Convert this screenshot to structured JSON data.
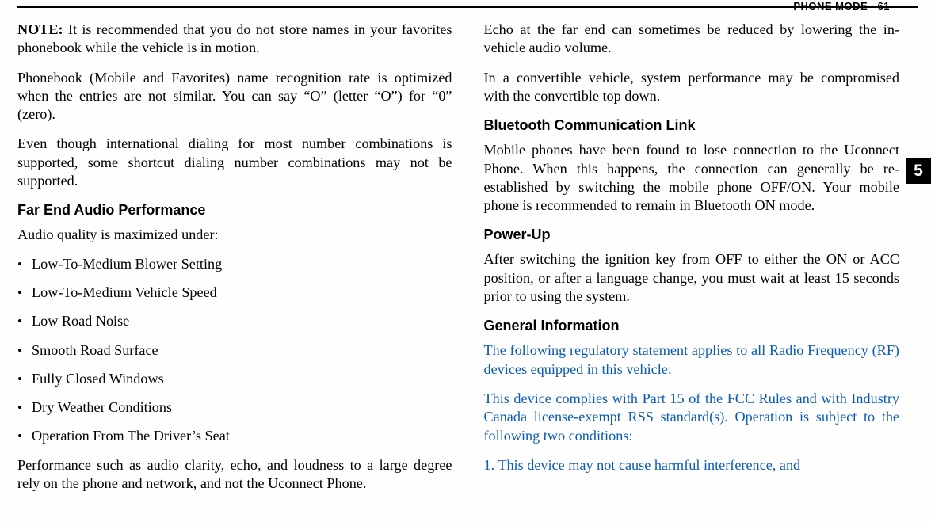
{
  "header": {
    "section": "PHONE MODE",
    "page_number": "61"
  },
  "tab": "5",
  "left": {
    "note_label": "NOTE:",
    "note_text": " It is recommended that you do not store names in your favorites phonebook while the vehicle is in motion.",
    "p2": "Phonebook (Mobile and Favorites) name recognition rate is optimized when the entries are not similar. You can say “O” (letter “O”) for “0” (zero).",
    "p3": "Even though international dialing for most number combinations is supported, some shortcut dialing number combinations may not be supported.",
    "h_far_end": "Far End Audio Performance",
    "p4": "Audio quality is maximized under:",
    "bullets": [
      "Low-To-Medium Blower Setting",
      "Low-To-Medium Vehicle Speed",
      "Low Road Noise",
      "Smooth Road Surface",
      "Fully Closed Windows",
      "Dry Weather Conditions",
      "Operation From The Driver’s Seat"
    ],
    "p5": "Performance such as audio clarity, echo, and loudness to a large degree rely on the phone and network, and not the Uconnect Phone."
  },
  "right": {
    "p1": "Echo at the far end can sometimes be reduced by lowering the in-vehicle audio volume.",
    "p2": "In a convertible vehicle, system performance may be compromised with the convertible top down.",
    "h_bt": "Bluetooth Communication Link",
    "p3": "Mobile phones have been found to lose connection to the Uconnect Phone. When this happens, the connection can generally be re-established by switching the mobile phone OFF/ON. Your mobile phone is recommended to remain in Bluetooth ON mode.",
    "h_power": "Power-Up",
    "p4": "After switching the ignition key from OFF to either the ON or ACC position, or after a language change, you must wait at least 15 seconds prior to using the system.",
    "h_general": "General Information",
    "p5": "The following regulatory statement applies to all Radio Frequency (RF) devices equipped in this vehicle:",
    "p6": "This device complies with Part 15 of the FCC Rules and with Industry Canada license-exempt RSS standard(s). Operation is subject to the following two conditions:",
    "p7": "1. This device may not cause harmful interference, and"
  }
}
